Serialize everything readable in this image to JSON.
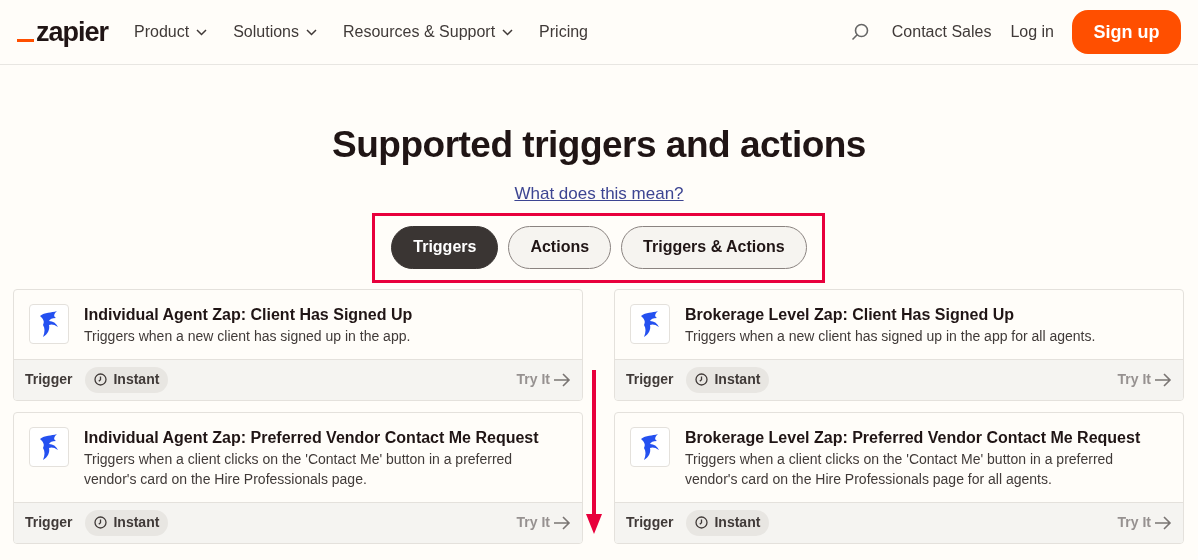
{
  "nav": {
    "logo": "zapier",
    "menu": [
      {
        "label": "Product",
        "dropdown": true
      },
      {
        "label": "Solutions",
        "dropdown": true
      },
      {
        "label": "Resources & Support",
        "dropdown": true
      },
      {
        "label": "Pricing",
        "dropdown": false
      }
    ],
    "contact": "Contact Sales",
    "login": "Log in",
    "signup": "Sign up"
  },
  "heading": "Supported triggers and actions",
  "help_link": "What does this mean?",
  "tabs": [
    {
      "label": "Triggers",
      "selected": true
    },
    {
      "label": "Actions",
      "selected": false
    },
    {
      "label": "Triggers & Actions",
      "selected": false
    }
  ],
  "cards": [
    {
      "title": "Individual Agent Zap: Client Has Signed Up",
      "description": "Triggers when a new client has signed up in the app.",
      "type": "Trigger",
      "badge": "Instant",
      "cta": "Try It"
    },
    {
      "title": "Brokerage Level Zap: Client Has Signed Up",
      "description": "Triggers when a new client has signed up in the app for all agents.",
      "type": "Trigger",
      "badge": "Instant",
      "cta": "Try It"
    },
    {
      "title": "Individual Agent Zap: Preferred Vendor Contact Me Request",
      "description": "Triggers when a client clicks on the 'Contact Me' button in a preferred vendor's card on the Hire Professionals page.",
      "type": "Trigger",
      "badge": "Instant",
      "cta": "Try It"
    },
    {
      "title": "Brokerage Level Zap: Preferred Vendor Contact Me Request",
      "description": "Triggers when a client clicks on the 'Contact Me' button in a preferred vendor's card on the Hire Professionals page for all agents.",
      "type": "Trigger",
      "badge": "Instant",
      "cta": "Try It"
    }
  ]
}
